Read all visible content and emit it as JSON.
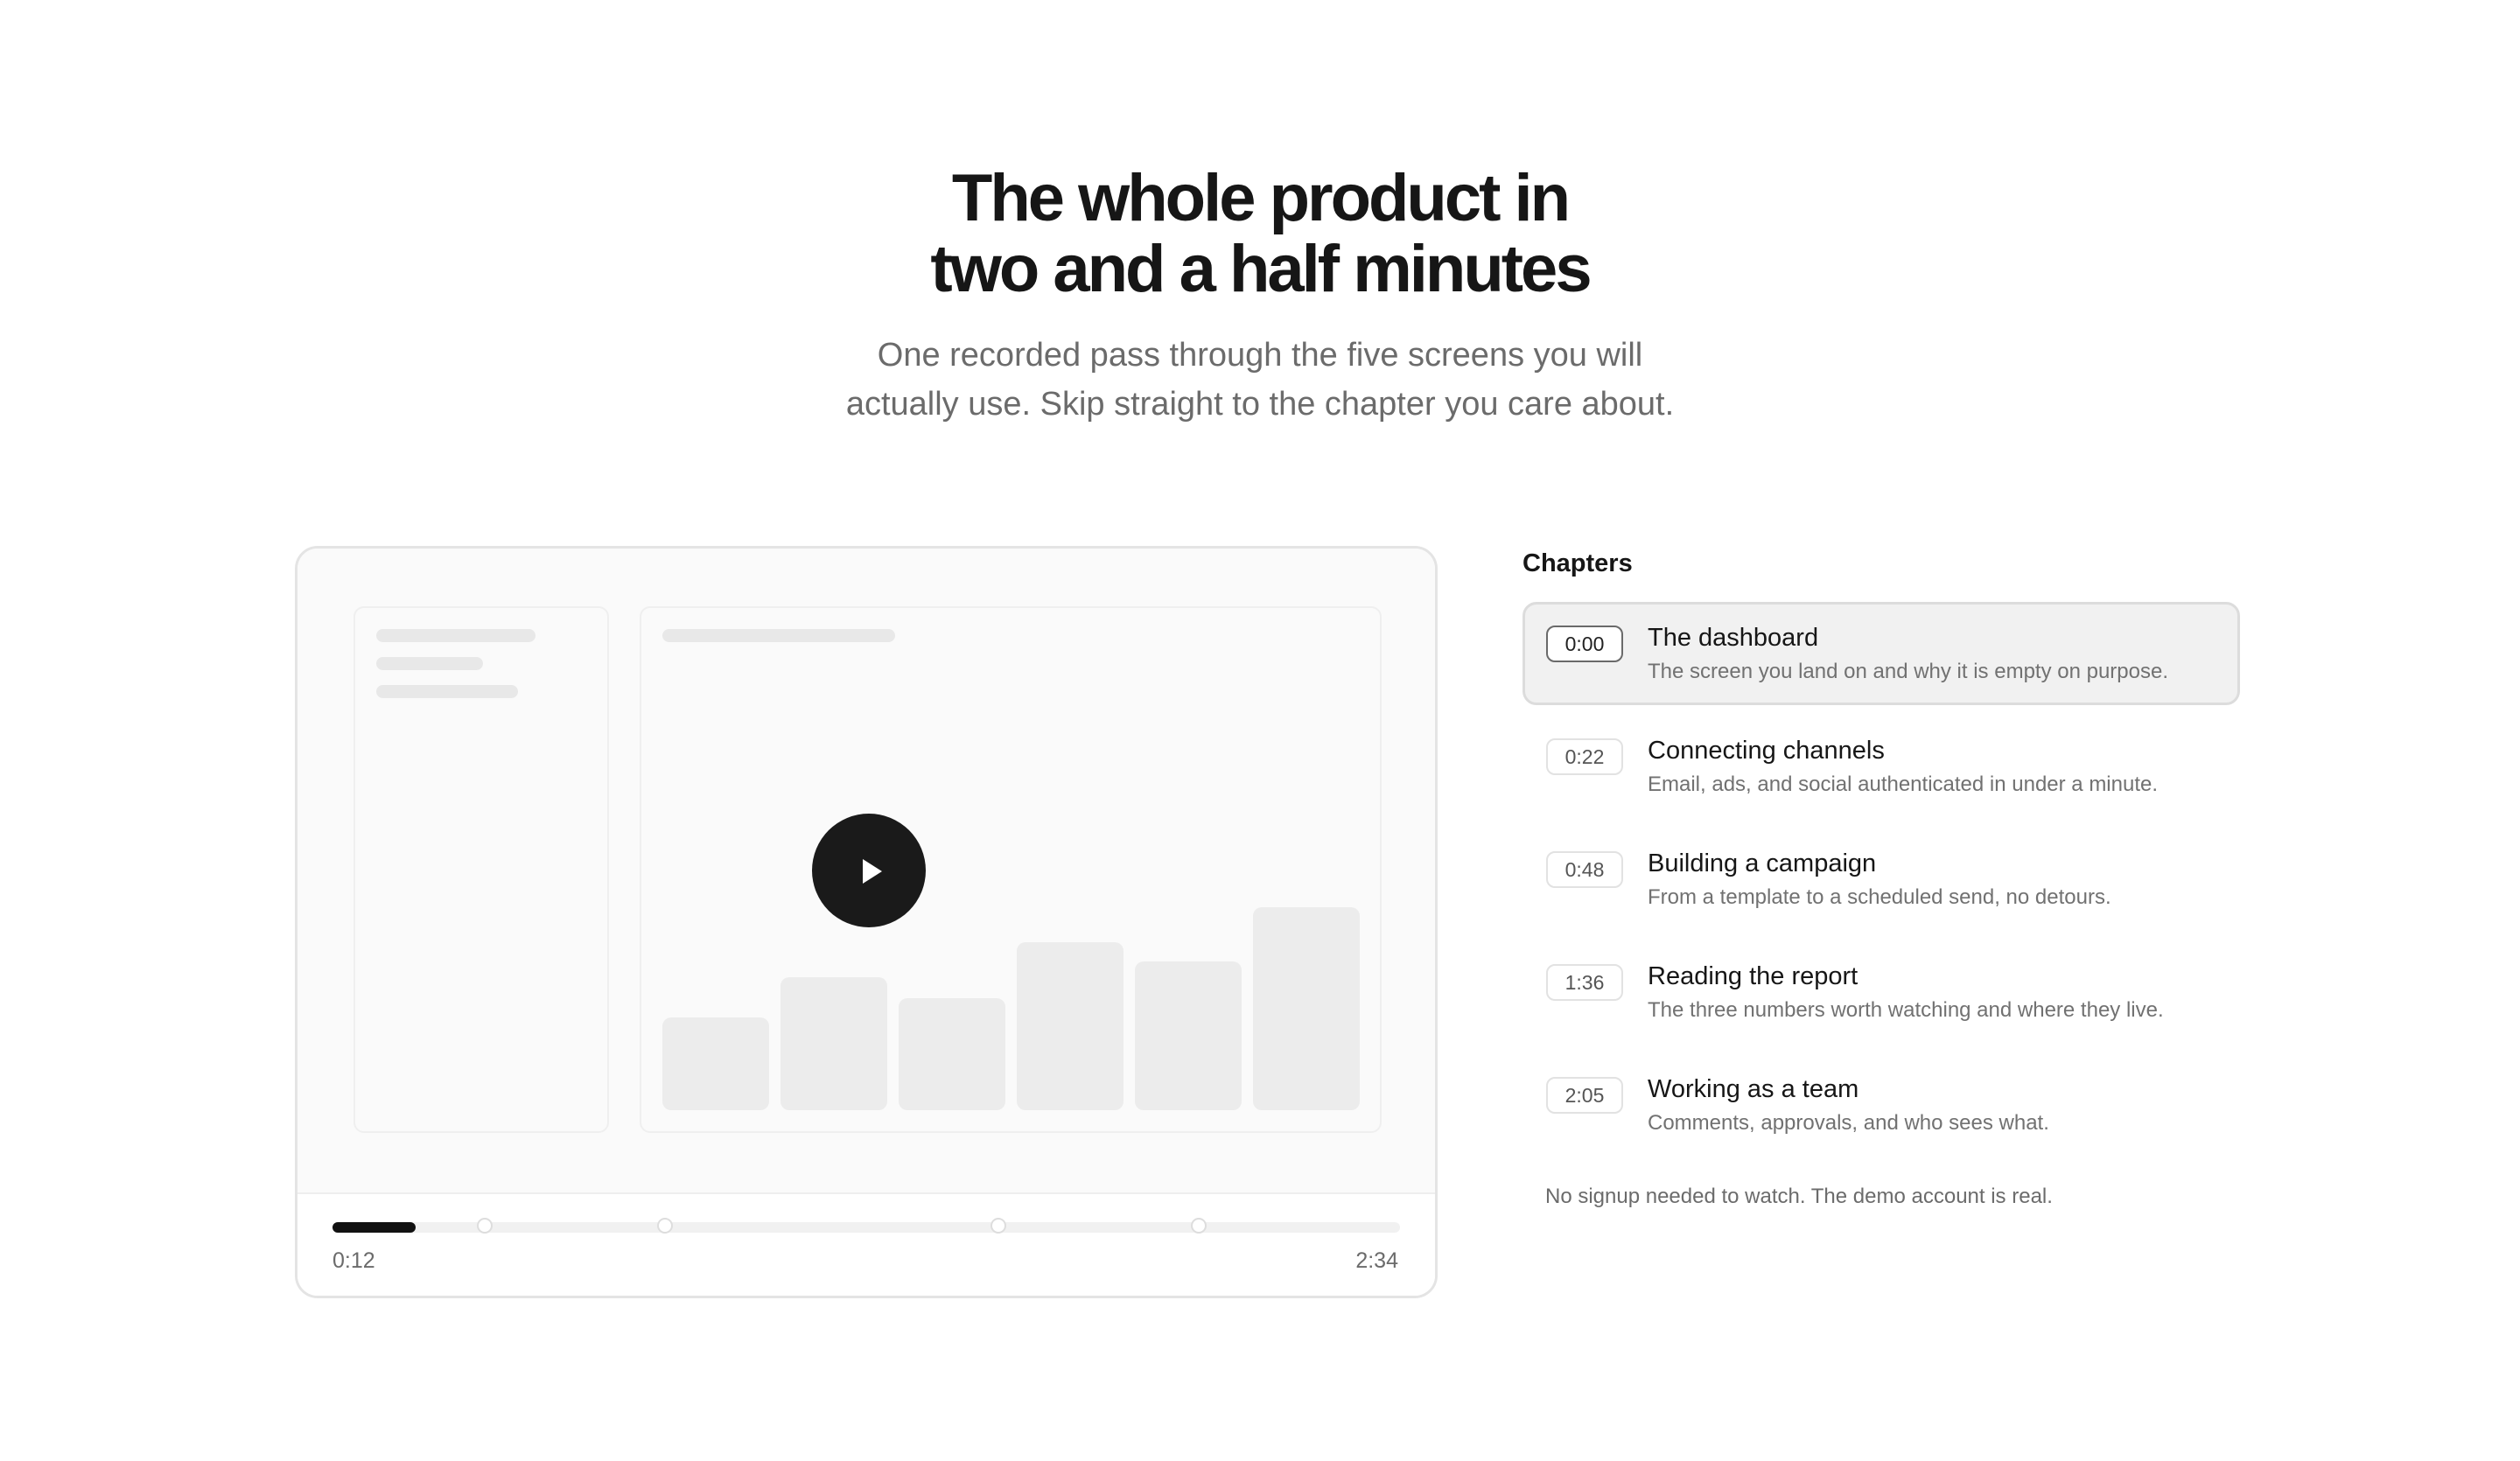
{
  "hero": {
    "title_line1": "The whole product in",
    "title_line2": "two and a half minutes",
    "subtitle_line1": "One recorded pass through the five screens you will",
    "subtitle_line2": "actually use. Skip straight to the chapter you care about."
  },
  "player": {
    "current_time": "0:12",
    "total_time": "2:34",
    "progress": 0.078,
    "chapter_markers_seconds": [
      22,
      48,
      96,
      125
    ],
    "duration_seconds": 154,
    "play_icon": "play-icon"
  },
  "chapters": {
    "heading": "Chapters",
    "items": [
      {
        "time": "0:00",
        "title": "The dashboard",
        "description": "The screen you land on and why it is empty on purpose.",
        "active": true
      },
      {
        "time": "0:22",
        "title": "Connecting channels",
        "description": "Email, ads, and social authenticated in under a minute.",
        "active": false
      },
      {
        "time": "0:48",
        "title": "Building a campaign",
        "description": "From a template to a scheduled send, no detours.",
        "active": false
      },
      {
        "time": "1:36",
        "title": "Reading the report",
        "description": "The three numbers worth watching and where they live.",
        "active": false
      },
      {
        "time": "2:05",
        "title": "Working as a team",
        "description": "Comments, approvals, and who sees what.",
        "active": false
      }
    ],
    "note": "No signup needed to watch. The demo account is real."
  },
  "colors": {
    "text": "#161616",
    "muted": "#6b6b6b",
    "accent": "#111111",
    "active_chapter_bg": "#f1f1f1"
  }
}
